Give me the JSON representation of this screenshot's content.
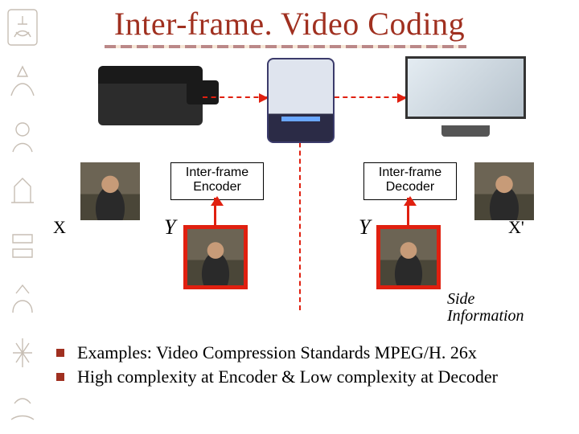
{
  "title": "Inter-frame. Video Coding",
  "blocks": {
    "encoder": {
      "line1": "Inter-frame",
      "line2": "Encoder"
    },
    "decoder": {
      "line1": "Inter-frame",
      "line2": "Decoder"
    }
  },
  "labels": {
    "x_left": "X",
    "x_right": "X'",
    "y_left": "Y",
    "y_right": "Y"
  },
  "side_info": {
    "line1": "Side",
    "line2": "Information"
  },
  "bullets": [
    "Examples: Video Compression Standards MPEG/H. 26x",
    "High complexity at Encoder & Low complexity at Decoder"
  ],
  "icons": {
    "camera": "camera-icon",
    "server": "server-tower-icon",
    "monitor": "flat-monitor-icon",
    "border": "egyptian-glyph-icon"
  },
  "colors": {
    "accent_red": "#e02010",
    "title_red": "#a03020"
  }
}
